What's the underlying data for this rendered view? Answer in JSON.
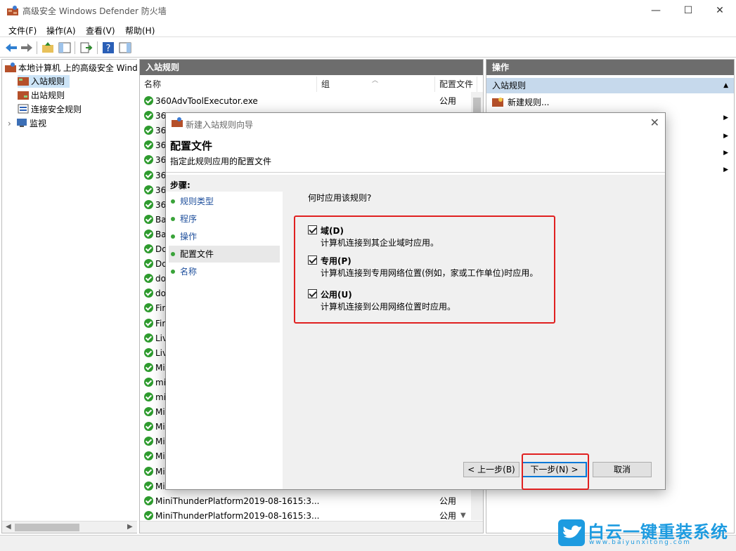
{
  "window": {
    "title": "高级安全 Windows Defender 防火墙"
  },
  "menu": [
    "文件(F)",
    "操作(A)",
    "查看(V)",
    "帮助(H)"
  ],
  "tree": {
    "root": "本地计算机 上的高级安全 Windo",
    "items": [
      "入站规则",
      "出站规则",
      "连接安全规则",
      "监视"
    ]
  },
  "center": {
    "header": "入站规则",
    "columns": [
      "名称",
      "组",
      "配置文件"
    ],
    "rows": [
      {
        "name": "360AdvToolExecutor.exe",
        "profile": "公用"
      },
      {
        "name": "36",
        "profile": ""
      },
      {
        "name": "36",
        "profile": ""
      },
      {
        "name": "36",
        "profile": ""
      },
      {
        "name": "36",
        "profile": ""
      },
      {
        "name": "36",
        "profile": ""
      },
      {
        "name": "36",
        "profile": ""
      },
      {
        "name": "36",
        "profile": ""
      },
      {
        "name": "Ba",
        "profile": ""
      },
      {
        "name": "Ba",
        "profile": ""
      },
      {
        "name": "Do",
        "profile": ""
      },
      {
        "name": "Do",
        "profile": ""
      },
      {
        "name": "do",
        "profile": ""
      },
      {
        "name": "do",
        "profile": ""
      },
      {
        "name": "Fir",
        "profile": ""
      },
      {
        "name": "Fir",
        "profile": ""
      },
      {
        "name": "Liv",
        "profile": ""
      },
      {
        "name": "Liv",
        "profile": ""
      },
      {
        "name": "Mi",
        "profile": ""
      },
      {
        "name": "mi",
        "profile": ""
      },
      {
        "name": "mi",
        "profile": ""
      },
      {
        "name": "Mi",
        "profile": ""
      },
      {
        "name": "Mi",
        "profile": ""
      },
      {
        "name": "Mi",
        "profile": ""
      },
      {
        "name": "Mi",
        "profile": ""
      },
      {
        "name": "Mi",
        "profile": ""
      },
      {
        "name": "Mi",
        "profile": ""
      },
      {
        "name": "MiniThunderPlatform2019-08-1615:3...",
        "profile": "公用"
      },
      {
        "name": "MiniThunderPlatform2019-08-1615:3...",
        "profile": "公用"
      }
    ]
  },
  "actions": {
    "header": "操作",
    "section": "入站规则",
    "new_rule": "新建规则..."
  },
  "dialog": {
    "title": "新建入站规则向导",
    "heading": "配置文件",
    "subheading": "指定此规则应用的配置文件",
    "steps_title": "步骤:",
    "steps": [
      "规则类型",
      "程序",
      "操作",
      "配置文件",
      "名称"
    ],
    "question": "何时应用该规则?",
    "options": [
      {
        "label": "域(D)",
        "desc": "计算机连接到其企业域时应用。"
      },
      {
        "label": "专用(P)",
        "desc": "计算机连接到专用网络位置(例如，家或工作单位)时应用。"
      },
      {
        "label": "公用(U)",
        "desc": "计算机连接到公用网络位置时应用。"
      }
    ],
    "back_label": "< 上一步(B)",
    "next_label": "下一步(N) >",
    "cancel_label": "取消"
  },
  "watermark": {
    "text": "白云一键重装系统",
    "url": "www.baiyunxitong.com"
  },
  "colors": {
    "accent": "#0078d7",
    "highlight_box": "#e02020",
    "header_gray": "#6d6d6d",
    "rule_green": "#2e9b2e"
  }
}
